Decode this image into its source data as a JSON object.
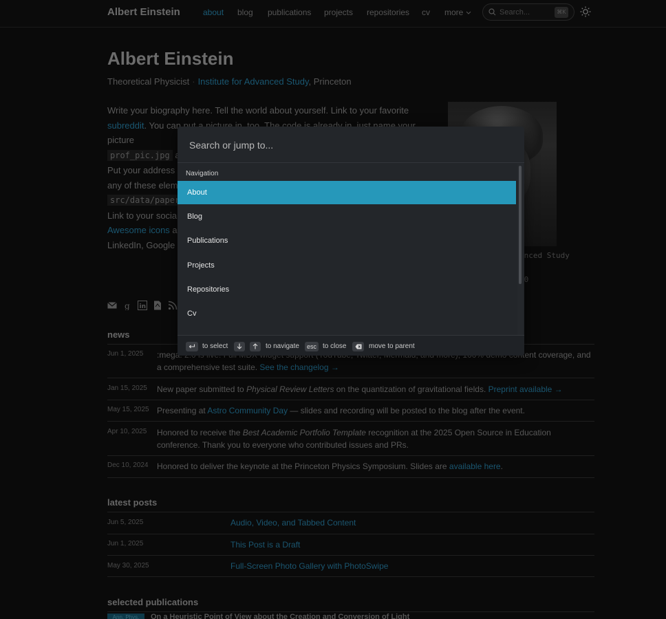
{
  "navbar": {
    "brand": "Albert Einstein",
    "items": [
      "about",
      "blog",
      "publications",
      "projects",
      "repositories",
      "cv",
      "more"
    ],
    "search_placeholder": "Search...",
    "search_shortcut": "⌘K"
  },
  "header": {
    "title": "Albert Einstein",
    "role": "Theoretical Physicist",
    "institution": "Institute for Advanced Study",
    "city": ", Princeton"
  },
  "bio": {
    "l1": "Write your biography here. Tell the world about yourself. Link to your favorite",
    "l2a": "subreddit",
    "l2b": ". You can put a picture in, too. The code is already in, just name your picture",
    "l3code": "prof_pic.jpg",
    "l3b": " ar",
    "l4": "Put your address /",
    "l5": "any of these eleme",
    "l6code": "src/data/paper",
    "l7": "Link to your social",
    "l8a": "Awesome icons",
    "l8b": " ar",
    "l9": "LinkedIn, Google S"
  },
  "profile": {
    "caption_line1": "anced Study",
    "caption_line2": "40"
  },
  "social_icons": [
    "email-icon",
    "google-scholar-icon",
    "linkedin-icon",
    "pdf-icon",
    "rss-icon"
  ],
  "news": {
    "title": "news",
    "items": [
      {
        "date": "Jun 1, 2025",
        "text": ":mega: 2.0 is live! Full MDX widget support (YouTube, Twitter, Mermaid, and more), 100% demo content coverage, and a comprehensive test suite.",
        "link": "See the changelog →"
      },
      {
        "date": "Jan 15, 2025",
        "pre": "New paper submitted to ",
        "em": "Physical Review Letters",
        "post": " on the quantization of gravitational fields. ",
        "link": "Preprint available →"
      },
      {
        "date": "May 15, 2025",
        "pre": "Presenting at ",
        "link": "Astro Community Day",
        "post": " — slides and recording will be posted to the blog after the event."
      },
      {
        "date": "Apr 10, 2025",
        "pre": "Honored to receive the ",
        "em": "Best Academic Portfolio Template",
        "post": " recognition at the 2025 Open Source in Education conference. Thank you to everyone who contributed issues and PRs."
      },
      {
        "date": "Dec 10, 2024",
        "pre": "Honored to deliver the keynote at the Princeton Physics Symposium. Slides are ",
        "link": "available here",
        "post": "."
      }
    ]
  },
  "latest_posts": {
    "title": "latest posts",
    "items": [
      {
        "date": "Jun 5, 2025",
        "title": "Audio, Video, and Tabbed Content"
      },
      {
        "date": "Jun 1, 2025",
        "title": "This Post is a Draft"
      },
      {
        "date": "May 30, 2025",
        "title": "Full-Screen Photo Gallery with PhotoSwipe"
      }
    ]
  },
  "publications": {
    "title": "selected publications",
    "badge": "Ann. Phys.",
    "first_title": "On a Heuristic Point of View about the Creation and Conversion of Light"
  },
  "modal": {
    "placeholder": "Search or jump to...",
    "section": "Navigation",
    "items": [
      "About",
      "Blog",
      "Publications",
      "Projects",
      "Repositories",
      "Cv"
    ],
    "footer": {
      "select": "to select",
      "navigate": "to navigate",
      "esc_key": "esc",
      "close": "to close",
      "parent": "move to parent"
    }
  },
  "colors": {
    "accent": "#2698ba",
    "modal_bg": "#23262a"
  }
}
